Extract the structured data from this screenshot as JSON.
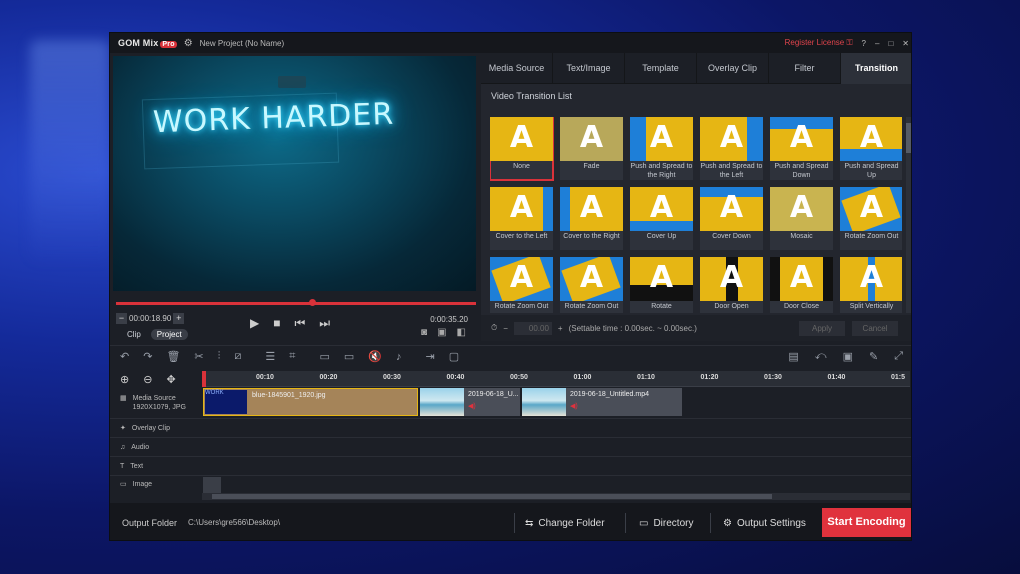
{
  "titlebar": {
    "logo": "GOM Mix",
    "logo_badge": "Pro",
    "project": "New Project (No Name)",
    "register_license": "Register License",
    "help": "?",
    "minimize": "–",
    "maximize": "□",
    "close": "✕"
  },
  "preview": {
    "neon_text": "WORK HARDER",
    "current_time": "00:00:18.90",
    "total_time": "0:00:35.20",
    "seek_fraction": 0.54,
    "tab_clip": "Clip",
    "tab_project": "Project"
  },
  "panel": {
    "tabs": [
      "Media Source",
      "Text/Image",
      "Template",
      "Overlay Clip",
      "Filter",
      "Transition"
    ],
    "active_tab": "Transition",
    "list_title": "Video Transition List",
    "transitions": [
      {
        "label": "None",
        "selected": true
      },
      {
        "label": "Fade"
      },
      {
        "label": "Push and Spread to the Right"
      },
      {
        "label": "Push and Spread to the Left"
      },
      {
        "label": "Push and Spread Down"
      },
      {
        "label": "Push and Spread Up"
      },
      {
        "label": "Cover to the Left"
      },
      {
        "label": "Cover to the Right"
      },
      {
        "label": "Cover Up"
      },
      {
        "label": "Cover Down"
      },
      {
        "label": "Mosaic"
      },
      {
        "label": "Rotate Zoom Out"
      },
      {
        "label": "Rotate Zoom Out"
      },
      {
        "label": "Rotate Zoom Out"
      },
      {
        "label": "Rotate"
      },
      {
        "label": "Door Open"
      },
      {
        "label": "Door Close"
      },
      {
        "label": "Split Vertically"
      }
    ],
    "duration_value": "00.00",
    "settable_time": "(Settable time : 0.00sec. ~ 0.00sec.)",
    "apply": "Apply",
    "cancel": "Cancel"
  },
  "timeline": {
    "ticks": [
      "00:10",
      "00:20",
      "00:30",
      "00:40",
      "00:50",
      "01:00",
      "01:10",
      "01:20",
      "01:30",
      "01:40",
      "01:5"
    ],
    "tracks": {
      "media_source": "Media Source",
      "media_source_info": "1920X1079, JPG",
      "overlay_clip": "Overlay Clip",
      "audio": "Audio",
      "text": "Text",
      "image": "Image"
    },
    "clips": [
      {
        "name": "blue-1845901_1920.jpg"
      },
      {
        "name": "2019-06-18_U..."
      },
      {
        "name": "2019-06-18_Untitled.mp4"
      }
    ]
  },
  "footer": {
    "output_folder_label": "Output Folder",
    "output_folder_path": "C:\\Users\\gre566\\Desktop\\",
    "change_folder": "Change Folder",
    "directory": "Directory",
    "output_settings": "Output Settings",
    "start_encoding": "Start Encoding"
  },
  "colors": {
    "accent": "#e0323d",
    "transition_yellow": "#e6b614",
    "transition_blue": "#1e7fd8"
  }
}
